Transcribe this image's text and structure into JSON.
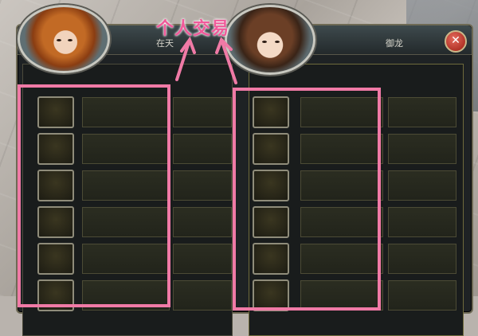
{
  "annotation": {
    "title": "个人交易"
  },
  "trade_window": {
    "left_player": {
      "name": "在天"
    },
    "right_player": {
      "name": "御龙"
    },
    "close_label": "✕"
  },
  "colors": {
    "highlight": "#f07aa6",
    "annotation_text": "#f05a9a"
  }
}
